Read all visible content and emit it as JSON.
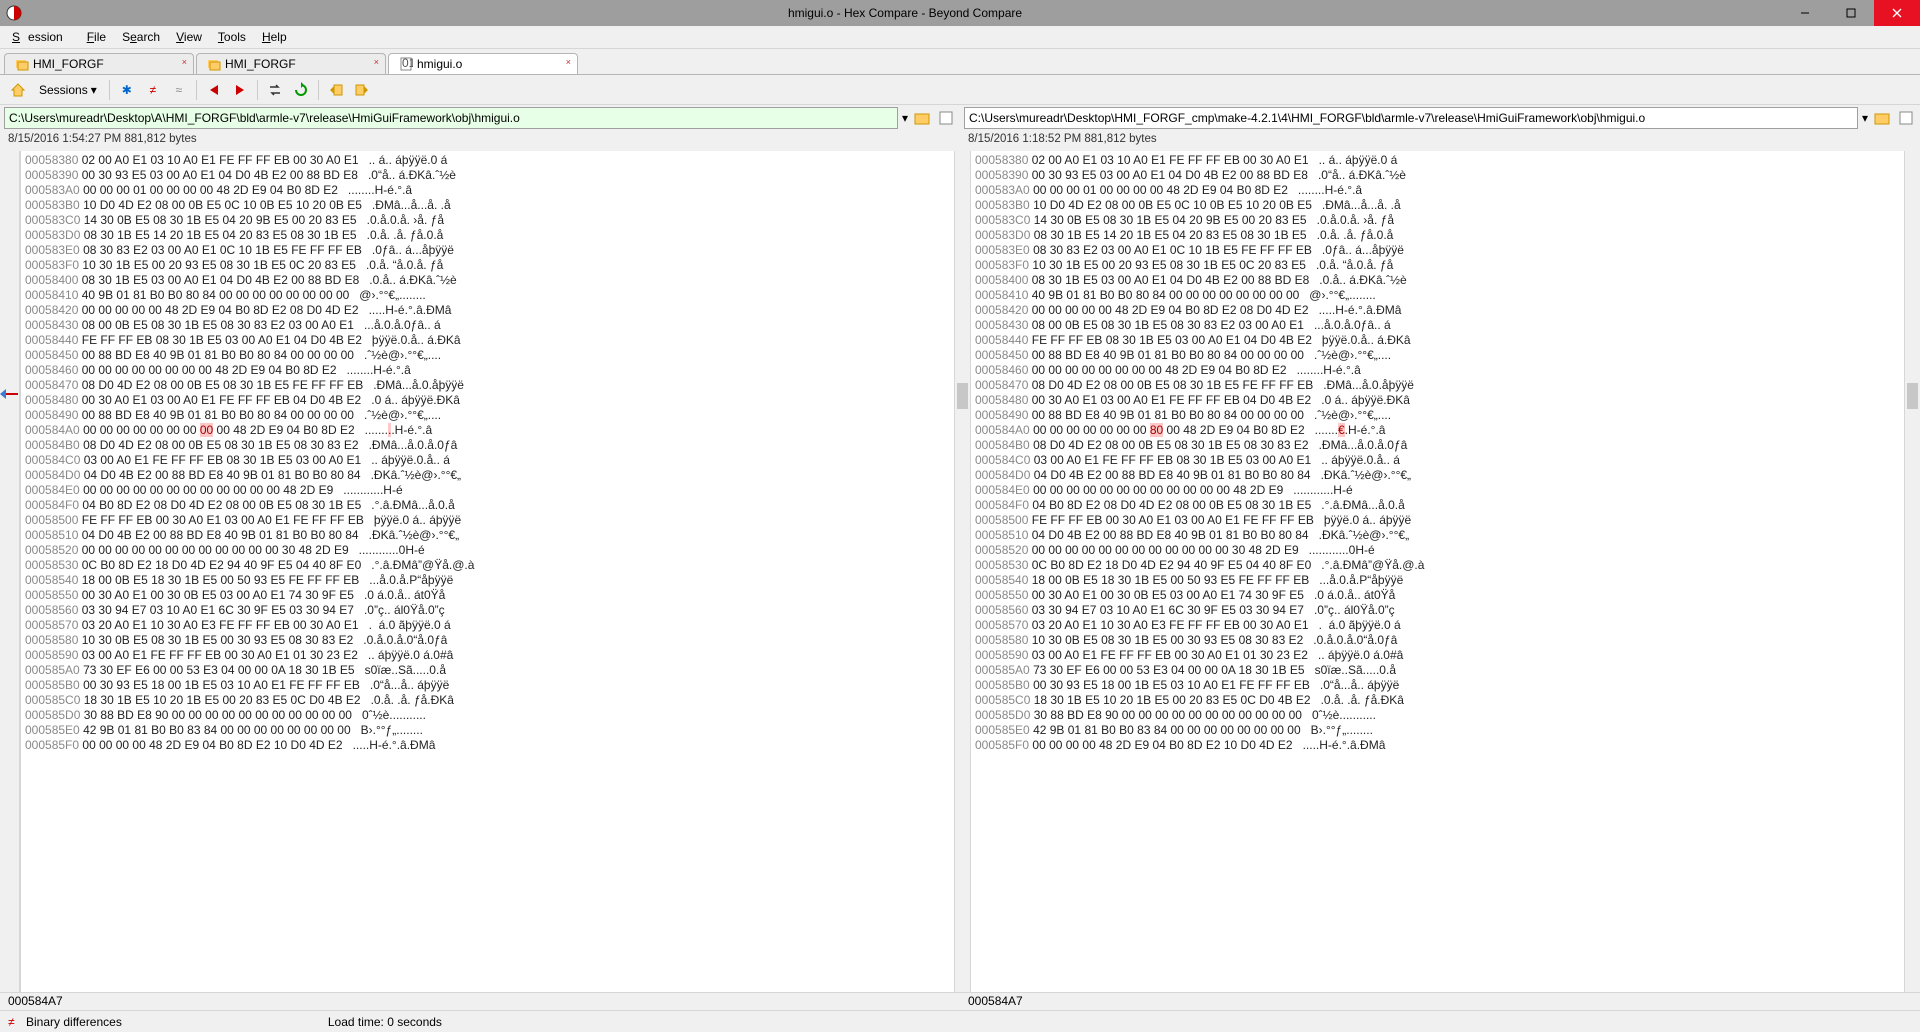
{
  "window": {
    "title": "hmigui.o - Hex Compare - Beyond Compare"
  },
  "menu": {
    "session": "Session",
    "file": "File",
    "search": "Search",
    "view": "View",
    "tools": "Tools",
    "help": "Help"
  },
  "tabs": [
    {
      "label": "HMI_FORGF",
      "active": false,
      "icon": "folder-pair"
    },
    {
      "label": "HMI_FORGF",
      "active": false,
      "icon": "folder-pair"
    },
    {
      "label": "hmigui.o",
      "active": true,
      "icon": "binary-file"
    }
  ],
  "toolbar": {
    "sessions_label": "Sessions",
    "home_icon": "home-icon",
    "refresh_icon": "refresh-icon",
    "next_diff_icon": "next-diff-icon",
    "prev_diff_icon": "prev-diff-icon",
    "swap_icon": "swap-icon",
    "reload_icon": "reload-icon",
    "copy_left_icon": "copy-left-icon",
    "copy_right_icon": "copy-right-icon"
  },
  "paths": {
    "left": "C:\\Users\\mureadr\\Desktop\\A\\HMI_FORGF\\bld\\armle-v7\\release\\HmiGuiFramework\\obj\\hmigui.o",
    "right": "C:\\Users\\mureadr\\Desktop\\HMI_FORGF_cmp\\make-4.2.1\\4\\HMI_FORGF\\bld\\armle-v7\\release\\HmiGuiFramework\\obj\\hmigui.o"
  },
  "meta": {
    "left": "8/15/2016 1:54:27 PM   881,812 bytes",
    "right": "8/15/2016 1:18:52 PM   881,812 bytes"
  },
  "hex": {
    "left": [
      {
        "addr": "00058380",
        "bytes": "02 00 A0 E1 03 10 A0 E1 FE FF FF EB 00 30 A0 E1",
        "ascii": ".. á.. áþÿÿë.0 á"
      },
      {
        "addr": "00058390",
        "bytes": "00 30 93 E5 03 00 A0 E1 04 D0 4B E2 00 88 BD E8",
        "ascii": ".0“å.. á.ÐKâ.ˆ½è"
      },
      {
        "addr": "000583A0",
        "bytes": "00 00 00 01 00 00 00 00 48 2D E9 04 B0 8D E2",
        "ascii": "........H-é.°.â"
      },
      {
        "addr": "000583B0",
        "bytes": "10 D0 4D E2 08 00 0B E5 0C 10 0B E5 10 20 0B E5",
        "ascii": ".ÐMâ...å...å. .å"
      },
      {
        "addr": "000583C0",
        "bytes": "14 30 0B E5 08 30 1B E5 04 20 9B E5 00 20 83 E5",
        "ascii": ".0.å.0.å. ›å. ƒå"
      },
      {
        "addr": "000583D0",
        "bytes": "08 30 1B E5 14 20 1B E5 04 20 83 E5 08 30 1B E5",
        "ascii": ".0.å. .å. ƒå.0.å"
      },
      {
        "addr": "000583E0",
        "bytes": "08 30 83 E2 03 00 A0 E1 0C 10 1B E5 FE FF FF EB",
        "ascii": ".0ƒâ.. á...åþÿÿë"
      },
      {
        "addr": "000583F0",
        "bytes": "10 30 1B E5 00 20 93 E5 08 30 1B E5 0C 20 83 E5",
        "ascii": ".0.å. “å.0.å. ƒå"
      },
      {
        "addr": "00058400",
        "bytes": "08 30 1B E5 03 00 A0 E1 04 D0 4B E2 00 88 BD E8",
        "ascii": ".0.å.. á.ÐKâ.ˆ½è"
      },
      {
        "addr": "00058410",
        "bytes": "40 9B 01 81 B0 B0 80 84 00 00 00 00 00 00 00 00",
        "ascii": "@›.°°€„........"
      },
      {
        "addr": "00058420",
        "bytes": "00 00 00 00 00 48 2D E9 04 B0 8D E2 08 D0 4D E2",
        "ascii": ".....H-é.°.â.ÐMâ"
      },
      {
        "addr": "00058430",
        "bytes": "08 00 0B E5 08 30 1B E5 08 30 83 E2 03 00 A0 E1",
        "ascii": "...å.0.å.0ƒâ.. á"
      },
      {
        "addr": "00058440",
        "bytes": "FE FF FF EB 08 30 1B E5 03 00 A0 E1 04 D0 4B E2",
        "ascii": "þÿÿë.0.å.. á.ÐKâ"
      },
      {
        "addr": "00058450",
        "bytes": "00 88 BD E8 40 9B 01 81 B0 B0 80 84 00 00 00 00",
        "ascii": ".ˆ½è@›.°°€„...."
      },
      {
        "addr": "00058460",
        "bytes": "00 00 00 00 00 00 00 00 48 2D E9 04 B0 8D E2",
        "ascii": "........H-é.°.â"
      },
      {
        "addr": "00058470",
        "bytes": "08 D0 4D E2 08 00 0B E5 08 30 1B E5 FE FF FF EB",
        "ascii": ".ÐMâ...å.0.åþÿÿë"
      },
      {
        "addr": "00058480",
        "bytes": "00 30 A0 E1 03 00 A0 E1 FE FF FF EB 04 D0 4B E2",
        "ascii": ".0 á.. áþÿÿë.ÐKâ"
      },
      {
        "addr": "00058490",
        "bytes": "00 88 BD E8 40 9B 01 81 B0 B0 80 84 00 00 00 00",
        "ascii": ".ˆ½è@›.°°€„...."
      },
      {
        "addr": "000584A0",
        "bytes_pre": "00 00 00 00 00 00 00 ",
        "diff": "00",
        "bytes_post": " 00 48 2D E9 04 B0 8D E2",
        "ascii_pre": ".......",
        "ascii_diff": ".",
        "ascii_post": ".H-é.°.â"
      },
      {
        "addr": "000584B0",
        "bytes": "08 D0 4D E2 08 00 0B E5 08 30 1B E5 08 30 83 E2",
        "ascii": ".ÐMâ...å.0.å.0ƒâ"
      },
      {
        "addr": "000584C0",
        "bytes": "03 00 A0 E1 FE FF FF EB 08 30 1B E5 03 00 A0 E1",
        "ascii": ".. áþÿÿë.0.å.. á"
      },
      {
        "addr": "000584D0",
        "bytes": "04 D0 4B E2 00 88 BD E8 40 9B 01 81 B0 B0 80 84",
        "ascii": ".ÐKâ.ˆ½è@›.°°€„"
      },
      {
        "addr": "000584E0",
        "bytes": "00 00 00 00 00 00 00 00 00 00 00 00 48 2D E9",
        "ascii": "............H-é"
      },
      {
        "addr": "000584F0",
        "bytes": "04 B0 8D E2 08 D0 4D E2 08 00 0B E5 08 30 1B E5",
        "ascii": ".°.â.ÐMâ...å.0.å"
      },
      {
        "addr": "00058500",
        "bytes": "FE FF FF EB 00 30 A0 E1 03 00 A0 E1 FE FF FF EB",
        "ascii": "þÿÿë.0 á.. áþÿÿë"
      },
      {
        "addr": "00058510",
        "bytes": "04 D0 4B E2 00 88 BD E8 40 9B 01 81 B0 B0 80 84",
        "ascii": ".ÐKâ.ˆ½è@›.°°€„"
      },
      {
        "addr": "00058520",
        "bytes": "00 00 00 00 00 00 00 00 00 00 00 00 30 48 2D E9",
        "ascii": "............0H-é"
      },
      {
        "addr": "00058530",
        "bytes": "0C B0 8D E2 18 D0 4D E2 94 40 9F E5 04 40 8F E0",
        "ascii": ".°.â.ÐMâ”@Ÿå.@.à"
      },
      {
        "addr": "00058540",
        "bytes": "18 00 0B E5 18 30 1B E5 00 50 93 E5 FE FF FF EB",
        "ascii": "...å.0.å.P“åþÿÿë"
      },
      {
        "addr": "00058550",
        "bytes": "00 30 A0 E1 00 30 0B E5 03 00 A0 E1 74 30 9F E5",
        "ascii": ".0 á.0.å.. át0Ÿå"
      },
      {
        "addr": "00058560",
        "bytes": "03 30 94 E7 03 10 A0 E1 6C 30 9F E5 03 30 94 E7",
        "ascii": ".0”ç.. ál0Ÿå.0”ç"
      },
      {
        "addr": "00058570",
        "bytes": "03 20 A0 E1 10 30 A0 E3 FE FF FF EB 00 30 A0 E1",
        "ascii": ".  á.0 ãþÿÿë.0 á"
      },
      {
        "addr": "00058580",
        "bytes": "10 30 0B E5 08 30 1B E5 00 30 93 E5 08 30 83 E2",
        "ascii": ".0.å.0.å.0“å.0ƒâ"
      },
      {
        "addr": "00058590",
        "bytes": "03 00 A0 E1 FE FF FF EB 00 30 A0 E1 01 30 23 E2",
        "ascii": ".. áþÿÿë.0 á.0#â"
      },
      {
        "addr": "000585A0",
        "bytes": "73 30 EF E6 00 00 53 E3 04 00 00 0A 18 30 1B E5",
        "ascii": "s0ïæ..Sã.....0.å"
      },
      {
        "addr": "000585B0",
        "bytes": "00 30 93 E5 18 00 1B E5 03 10 A0 E1 FE FF FF EB",
        "ascii": ".0“å...å.. áþÿÿë"
      },
      {
        "addr": "000585C0",
        "bytes": "18 30 1B E5 10 20 1B E5 00 20 83 E5 0C D0 4B E2",
        "ascii": ".0.å. .å. ƒå.ÐKâ"
      },
      {
        "addr": "000585D0",
        "bytes": "30 88 BD E8 90 00 00 00 00 00 00 00 00 00 00 00",
        "ascii": "0ˆ½è..........."
      },
      {
        "addr": "000585E0",
        "bytes": "42 9B 01 81 B0 B0 83 84 00 00 00 00 00 00 00 00",
        "ascii": "B›.°°ƒ„........"
      },
      {
        "addr": "000585F0",
        "bytes": "00 00 00 00 48 2D E9 04 B0 8D E2 10 D0 4D E2",
        "ascii": ".....H-é.°.â.ÐMâ"
      }
    ],
    "right": [
      {
        "addr": "00058380",
        "bytes": "02 00 A0 E1 03 10 A0 E1 FE FF FF EB 00 30 A0 E1",
        "ascii": ".. á.. áþÿÿë.0 á"
      },
      {
        "addr": "00058390",
        "bytes": "00 30 93 E5 03 00 A0 E1 04 D0 4B E2 00 88 BD E8",
        "ascii": ".0“å.. á.ÐKâ.ˆ½è"
      },
      {
        "addr": "000583A0",
        "bytes": "00 00 00 01 00 00 00 00 48 2D E9 04 B0 8D E2",
        "ascii": "........H-é.°.â"
      },
      {
        "addr": "000583B0",
        "bytes": "10 D0 4D E2 08 00 0B E5 0C 10 0B E5 10 20 0B E5",
        "ascii": ".ÐMâ...å...å. .å"
      },
      {
        "addr": "000583C0",
        "bytes": "14 30 0B E5 08 30 1B E5 04 20 9B E5 00 20 83 E5",
        "ascii": ".0.å.0.å. ›å. ƒå"
      },
      {
        "addr": "000583D0",
        "bytes": "08 30 1B E5 14 20 1B E5 04 20 83 E5 08 30 1B E5",
        "ascii": ".0.å. .å. ƒå.0.å"
      },
      {
        "addr": "000583E0",
        "bytes": "08 30 83 E2 03 00 A0 E1 0C 10 1B E5 FE FF FF EB",
        "ascii": ".0ƒâ.. á...åþÿÿë"
      },
      {
        "addr": "000583F0",
        "bytes": "10 30 1B E5 00 20 93 E5 08 30 1B E5 0C 20 83 E5",
        "ascii": ".0.å. “å.0.å. ƒå"
      },
      {
        "addr": "00058400",
        "bytes": "08 30 1B E5 03 00 A0 E1 04 D0 4B E2 00 88 BD E8",
        "ascii": ".0.å.. á.ÐKâ.ˆ½è"
      },
      {
        "addr": "00058410",
        "bytes": "40 9B 01 81 B0 B0 80 84 00 00 00 00 00 00 00 00",
        "ascii": "@›.°°€„........"
      },
      {
        "addr": "00058420",
        "bytes": "00 00 00 00 00 48 2D E9 04 B0 8D E2 08 D0 4D E2",
        "ascii": ".....H-é.°.â.ÐMâ"
      },
      {
        "addr": "00058430",
        "bytes": "08 00 0B E5 08 30 1B E5 08 30 83 E2 03 00 A0 E1",
        "ascii": "...å.0.å.0ƒâ.. á"
      },
      {
        "addr": "00058440",
        "bytes": "FE FF FF EB 08 30 1B E5 03 00 A0 E1 04 D0 4B E2",
        "ascii": "þÿÿë.0.å.. á.ÐKâ"
      },
      {
        "addr": "00058450",
        "bytes": "00 88 BD E8 40 9B 01 81 B0 B0 80 84 00 00 00 00",
        "ascii": ".ˆ½è@›.°°€„...."
      },
      {
        "addr": "00058460",
        "bytes": "00 00 00 00 00 00 00 00 48 2D E9 04 B0 8D E2",
        "ascii": "........H-é.°.â"
      },
      {
        "addr": "00058470",
        "bytes": "08 D0 4D E2 08 00 0B E5 08 30 1B E5 FE FF FF EB",
        "ascii": ".ÐMâ...å.0.åþÿÿë"
      },
      {
        "addr": "00058480",
        "bytes": "00 30 A0 E1 03 00 A0 E1 FE FF FF EB 04 D0 4B E2",
        "ascii": ".0 á.. áþÿÿë.ÐKâ"
      },
      {
        "addr": "00058490",
        "bytes": "00 88 BD E8 40 9B 01 81 B0 B0 80 84 00 00 00 00",
        "ascii": ".ˆ½è@›.°°€„...."
      },
      {
        "addr": "000584A0",
        "bytes_pre": "00 00 00 00 00 00 00 ",
        "diff": "80",
        "bytes_post": " 00 48 2D E9 04 B0 8D E2",
        "ascii_pre": ".......",
        "ascii_diff": "€",
        "ascii_post": ".H-é.°.â"
      },
      {
        "addr": "000584B0",
        "bytes": "08 D0 4D E2 08 00 0B E5 08 30 1B E5 08 30 83 E2",
        "ascii": ".ÐMâ...å.0.å.0ƒâ"
      },
      {
        "addr": "000584C0",
        "bytes": "03 00 A0 E1 FE FF FF EB 08 30 1B E5 03 00 A0 E1",
        "ascii": ".. áþÿÿë.0.å.. á"
      },
      {
        "addr": "000584D0",
        "bytes": "04 D0 4B E2 00 88 BD E8 40 9B 01 81 B0 B0 80 84",
        "ascii": ".ÐKâ.ˆ½è@›.°°€„"
      },
      {
        "addr": "000584E0",
        "bytes": "00 00 00 00 00 00 00 00 00 00 00 00 48 2D E9",
        "ascii": "............H-é"
      },
      {
        "addr": "000584F0",
        "bytes": "04 B0 8D E2 08 D0 4D E2 08 00 0B E5 08 30 1B E5",
        "ascii": ".°.â.ÐMâ...å.0.å"
      },
      {
        "addr": "00058500",
        "bytes": "FE FF FF EB 00 30 A0 E1 03 00 A0 E1 FE FF FF EB",
        "ascii": "þÿÿë.0 á.. áþÿÿë"
      },
      {
        "addr": "00058510",
        "bytes": "04 D0 4B E2 00 88 BD E8 40 9B 01 81 B0 B0 80 84",
        "ascii": ".ÐKâ.ˆ½è@›.°°€„"
      },
      {
        "addr": "00058520",
        "bytes": "00 00 00 00 00 00 00 00 00 00 00 00 30 48 2D E9",
        "ascii": "............0H-é"
      },
      {
        "addr": "00058530",
        "bytes": "0C B0 8D E2 18 D0 4D E2 94 40 9F E5 04 40 8F E0",
        "ascii": ".°.â.ÐMâ”@Ÿå.@.à"
      },
      {
        "addr": "00058540",
        "bytes": "18 00 0B E5 18 30 1B E5 00 50 93 E5 FE FF FF EB",
        "ascii": "...å.0.å.P“åþÿÿë"
      },
      {
        "addr": "00058550",
        "bytes": "00 30 A0 E1 00 30 0B E5 03 00 A0 E1 74 30 9F E5",
        "ascii": ".0 á.0.å.. át0Ÿå"
      },
      {
        "addr": "00058560",
        "bytes": "03 30 94 E7 03 10 A0 E1 6C 30 9F E5 03 30 94 E7",
        "ascii": ".0”ç.. ál0Ÿå.0”ç"
      },
      {
        "addr": "00058570",
        "bytes": "03 20 A0 E1 10 30 A0 E3 FE FF FF EB 00 30 A0 E1",
        "ascii": ".  á.0 ãþÿÿë.0 á"
      },
      {
        "addr": "00058580",
        "bytes": "10 30 0B E5 08 30 1B E5 00 30 93 E5 08 30 83 E2",
        "ascii": ".0.å.0.å.0“å.0ƒâ"
      },
      {
        "addr": "00058590",
        "bytes": "03 00 A0 E1 FE FF FF EB 00 30 A0 E1 01 30 23 E2",
        "ascii": ".. áþÿÿë.0 á.0#â"
      },
      {
        "addr": "000585A0",
        "bytes": "73 30 EF E6 00 00 53 E3 04 00 00 0A 18 30 1B E5",
        "ascii": "s0ïæ..Sã.....0.å"
      },
      {
        "addr": "000585B0",
        "bytes": "00 30 93 E5 18 00 1B E5 03 10 A0 E1 FE FF FF EB",
        "ascii": ".0“å...å.. áþÿÿë"
      },
      {
        "addr": "000585C0",
        "bytes": "18 30 1B E5 10 20 1B E5 00 20 83 E5 0C D0 4B E2",
        "ascii": ".0.å. .å. ƒå.ÐKâ"
      },
      {
        "addr": "000585D0",
        "bytes": "30 88 BD E8 90 00 00 00 00 00 00 00 00 00 00 00",
        "ascii": "0ˆ½è..........."
      },
      {
        "addr": "000585E0",
        "bytes": "42 9B 01 81 B0 B0 83 84 00 00 00 00 00 00 00 00",
        "ascii": "B›.°°ƒ„........"
      },
      {
        "addr": "000585F0",
        "bytes": "00 00 00 00 48 2D E9 04 B0 8D E2 10 D0 4D E2",
        "ascii": ".....H-é.°.â.ÐMâ"
      }
    ]
  },
  "current_addr": {
    "left": "000584A7",
    "right": "000584A7"
  },
  "status": {
    "label": "Binary differences",
    "load_time": "Load time: 0 seconds"
  }
}
